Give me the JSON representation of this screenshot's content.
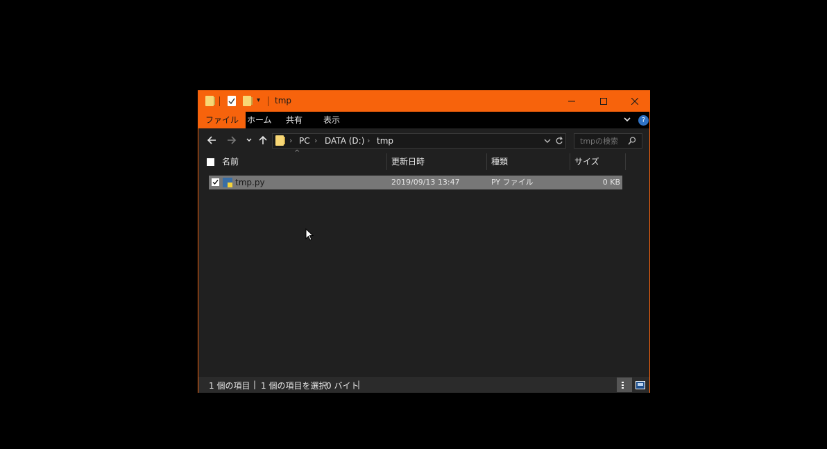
{
  "window": {
    "title": "tmp"
  },
  "ribbon": {
    "tabs": [
      {
        "label": "ファイル",
        "active": true
      },
      {
        "label": "ホーム",
        "active": false
      },
      {
        "label": "共有",
        "active": false
      },
      {
        "label": "表示",
        "active": false
      }
    ],
    "help": "?"
  },
  "address": {
    "crumbs": [
      "PC",
      "DATA (D:)",
      "tmp"
    ]
  },
  "search": {
    "placeholder": "tmpの検索"
  },
  "columns": {
    "name": "名前",
    "date": "更新日時",
    "type": "種類",
    "size": "サイズ"
  },
  "files": [
    {
      "name": "tmp.py",
      "date": "2019/09/13 13:47",
      "type": "PY ファイル",
      "size": "0 KB",
      "selected": true
    }
  ],
  "status": {
    "count": "1 個の項目",
    "selected": "1 個の項目を選択",
    "bytes": "0 バイト"
  },
  "colors": {
    "accent": "#f7630c",
    "background": "#202020",
    "selected_row": "#777777"
  }
}
